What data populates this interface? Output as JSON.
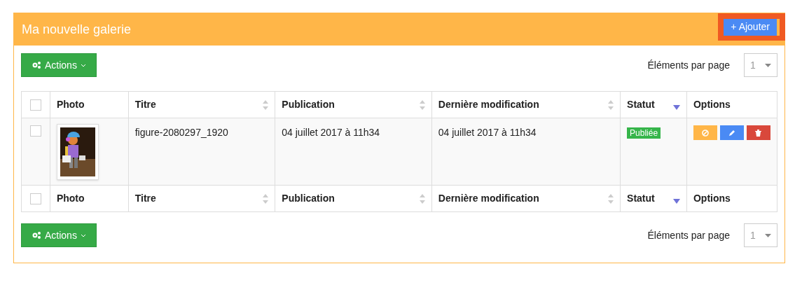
{
  "panel": {
    "title": "Ma nouvelle galerie",
    "add_button": "+ Ajouter",
    "add_highlighted": true
  },
  "toolbars": [
    {
      "actions": "Actions",
      "per_page_label": "Éléments par page",
      "per_page_value": "1"
    },
    {
      "actions": "Actions",
      "per_page_label": "Éléments par page",
      "per_page_value": "1"
    }
  ],
  "table": {
    "header": {
      "checked": false,
      "columns": [
        {
          "label": "Photo",
          "kind": "plain"
        },
        {
          "label": "Titre",
          "kind": "sortable"
        },
        {
          "label": "Publication",
          "kind": "sortable"
        },
        {
          "label": "Dernière modification",
          "kind": "sortable"
        },
        {
          "label": "Statut",
          "kind": "sorted"
        },
        {
          "label": "Options",
          "kind": "plain"
        }
      ]
    },
    "rows": [
      {
        "checked": false,
        "title": "figure-2080297_1920",
        "publication": "04 juillet 2017 à 11h34",
        "modification": "04 juillet 2017 à 11h34",
        "status": "Publiée",
        "options": [
          {
            "kind": "disable"
          },
          {
            "kind": "edit"
          },
          {
            "kind": "delete"
          }
        ]
      }
    ],
    "footer": {
      "checked": false,
      "columns": [
        {
          "label": "Photo",
          "kind": "plain"
        },
        {
          "label": "Titre",
          "kind": "sortable"
        },
        {
          "label": "Publication",
          "kind": "sortable"
        },
        {
          "label": "Dernière modification",
          "kind": "sortable"
        },
        {
          "label": "Statut",
          "kind": "sorted"
        },
        {
          "label": "Options",
          "kind": "plain"
        }
      ]
    }
  }
}
